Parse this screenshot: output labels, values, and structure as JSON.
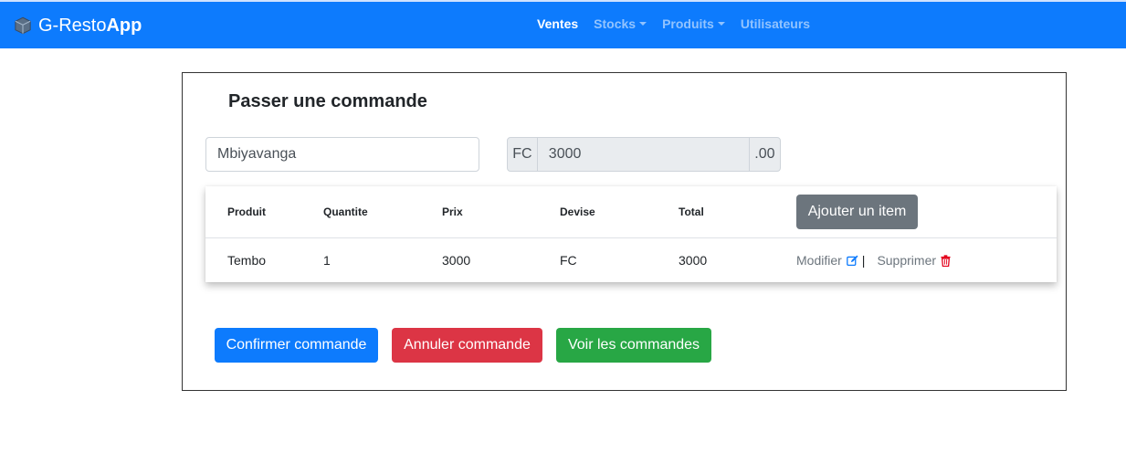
{
  "navbar": {
    "brand_part1": "G-Resto",
    "brand_part2": "App",
    "brand_icon": "cube-icon",
    "items": [
      {
        "label": "Ventes",
        "active": true,
        "dropdown": false
      },
      {
        "label": "Stocks",
        "active": false,
        "dropdown": true
      },
      {
        "label": "Produits",
        "active": false,
        "dropdown": true
      },
      {
        "label": "Utilisateurs",
        "active": false,
        "dropdown": false
      }
    ],
    "bg_color": "#0d7bfd"
  },
  "order": {
    "title": "Passer une commande",
    "client_name": "Mbiyavanga",
    "currency_prefix": "FC",
    "amount": "3000",
    "amount_suffix": ".00"
  },
  "table": {
    "headers": [
      "Produit",
      "Quantite",
      "Prix",
      "Devise",
      "Total"
    ],
    "add_item_label": "Ajouter un item",
    "rows": [
      {
        "produit": "Tembo",
        "quantite": "1",
        "prix": "3000",
        "devise": "FC",
        "total": "3000",
        "edit_label": "Modifier",
        "separator": "|",
        "delete_label": "Supprimer"
      }
    ]
  },
  "actions": {
    "confirm_label": "Confirmer commande",
    "cancel_label": "Annuler commande",
    "view_label": "Voir les commandes"
  },
  "colors": {
    "primary": "#0d7bfd",
    "danger": "#dc3545",
    "success": "#28a745",
    "secondary": "#6c757d"
  }
}
